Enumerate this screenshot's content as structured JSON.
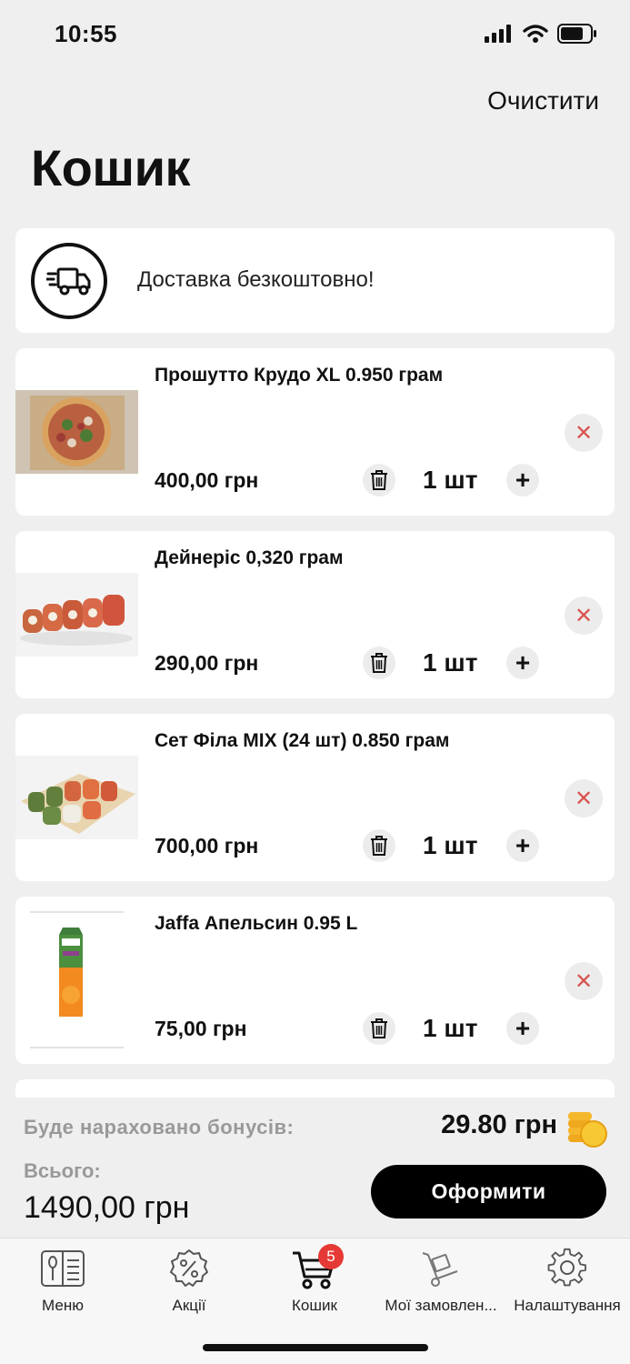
{
  "status_bar": {
    "time": "10:55"
  },
  "header": {
    "clear_label": "Очистити",
    "title": "Кошик"
  },
  "delivery": {
    "text": "Доставка безкоштовно!",
    "icon": "truck-icon"
  },
  "items": [
    {
      "name": "Прошутто Крудо XL 0.950 грам",
      "price": "400,00 грн",
      "qty": "1 шт",
      "thumb": "pizza"
    },
    {
      "name": "Дейнеріс 0,320 грам",
      "price": "290,00 грн",
      "qty": "1 шт",
      "thumb": "sushi-roll"
    },
    {
      "name": "Сет Філа MIX (24 шт) 0.850 грам",
      "price": "700,00 грн",
      "qty": "1 шт",
      "thumb": "sushi-set"
    },
    {
      "name": "Jaffa Апельсин 0.95 L",
      "price": "75,00 грн",
      "qty": "1 шт",
      "thumb": "juice-carton"
    }
  ],
  "summary": {
    "bonus_label": "Буде нараховано бонусів:",
    "bonus_value": "29.80 грн",
    "total_label": "Всього:",
    "total_value": "1490,00 грн",
    "checkout_label": "Оформити"
  },
  "tabs": [
    {
      "label": "Меню",
      "icon": "menu-book-icon"
    },
    {
      "label": "Акції",
      "icon": "discount-icon"
    },
    {
      "label": "Кошик",
      "icon": "cart-icon",
      "badge": "5",
      "active": true
    },
    {
      "label": "Мої замовлен...",
      "icon": "delivery-dolly-icon"
    },
    {
      "label": "Налаштування",
      "icon": "settings-gear-icon"
    }
  ],
  "colors": {
    "accent": "#000000",
    "remove": "#d9534f",
    "badge": "#e53935",
    "background": "#efefef"
  }
}
